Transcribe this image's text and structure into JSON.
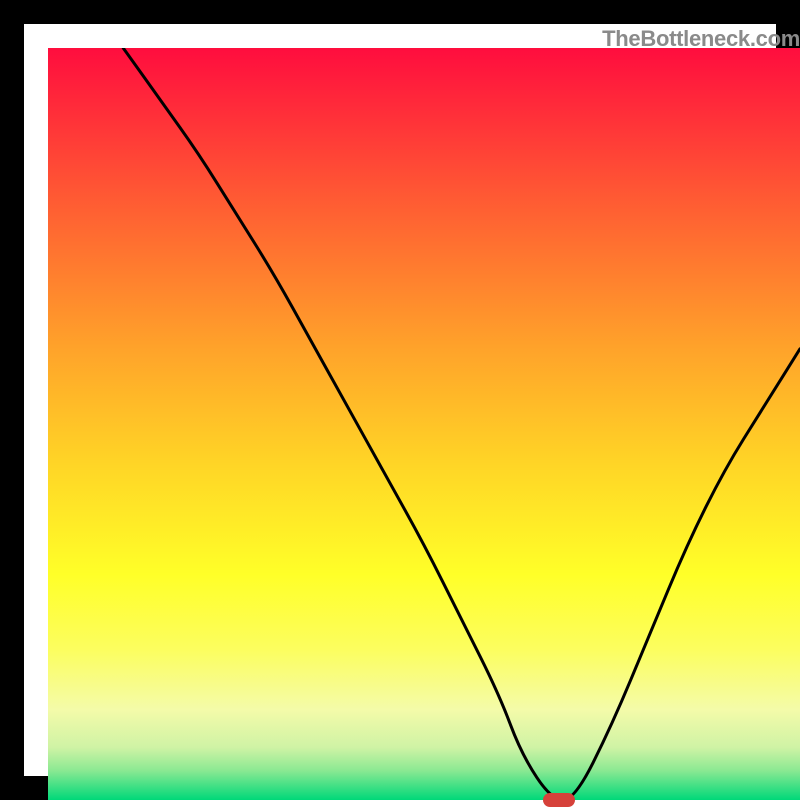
{
  "watermark": "TheBottleneck.com",
  "chart_data": {
    "type": "line",
    "title": "",
    "xlabel": "",
    "ylabel": "",
    "xlim": [
      0,
      100
    ],
    "ylim": [
      0,
      100
    ],
    "x": [
      10,
      15,
      20,
      25,
      30,
      35,
      40,
      45,
      50,
      55,
      60,
      63,
      67,
      70,
      75,
      80,
      85,
      90,
      95,
      100
    ],
    "values": [
      100,
      93,
      86,
      78,
      70,
      61,
      52,
      43,
      34,
      24,
      14,
      6,
      0,
      0,
      10,
      22,
      34,
      44,
      52,
      60
    ],
    "minimum_x": 68,
    "marker": {
      "x": 68,
      "y": 0
    },
    "background": {
      "type": "vertical-gradient",
      "stops": [
        {
          "offset": 0.0,
          "color": "#ff0d3e"
        },
        {
          "offset": 0.2,
          "color": "#ff5a33"
        },
        {
          "offset": 0.4,
          "color": "#ffa32a"
        },
        {
          "offset": 0.55,
          "color": "#ffd426"
        },
        {
          "offset": 0.7,
          "color": "#ffff28"
        },
        {
          "offset": 0.8,
          "color": "#fcfe5f"
        },
        {
          "offset": 0.88,
          "color": "#f4fba9"
        },
        {
          "offset": 0.93,
          "color": "#cff3a5"
        },
        {
          "offset": 0.96,
          "color": "#8de993"
        },
        {
          "offset": 1.0,
          "color": "#00d879"
        }
      ]
    },
    "line_style": {
      "color": "#000000",
      "width": 3
    }
  }
}
